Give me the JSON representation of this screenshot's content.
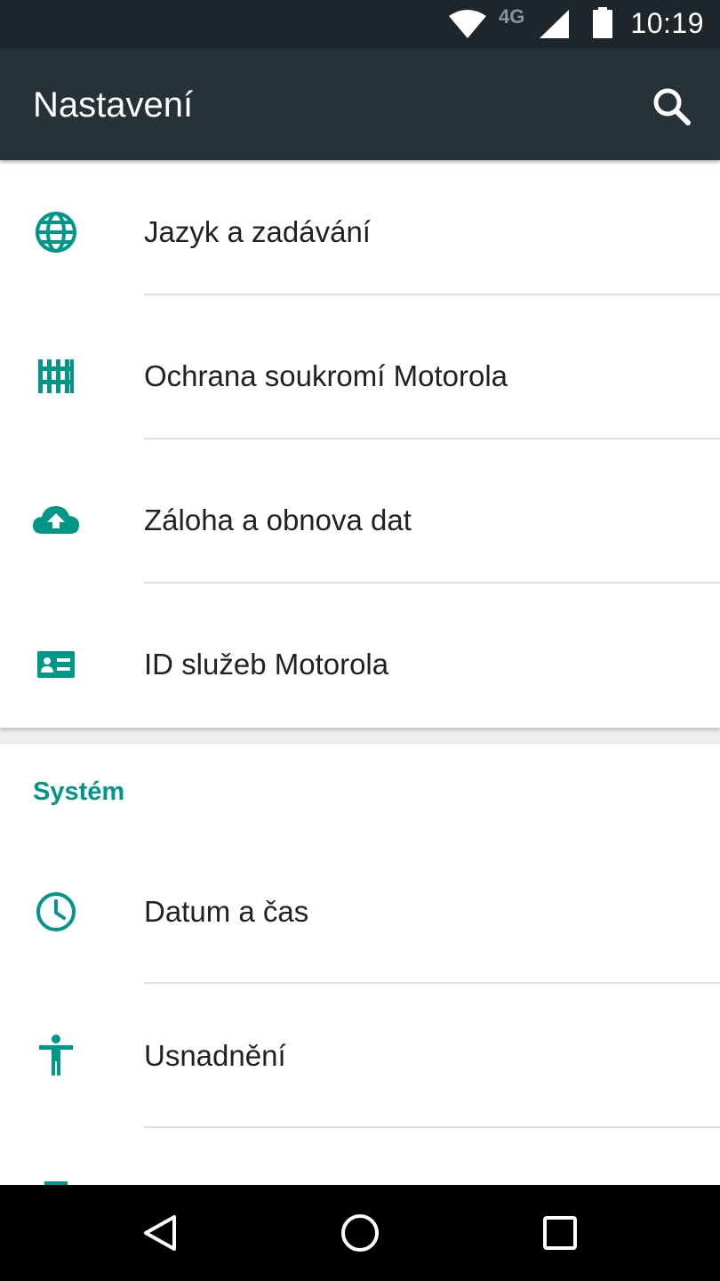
{
  "status_bar": {
    "network": "4G",
    "time": "10:19",
    "icons": [
      "wifi-icon",
      "cell-signal-icon",
      "battery-icon"
    ]
  },
  "app_bar": {
    "title": "Nastavení",
    "search_icon": "search-icon"
  },
  "accent_color": "#009688",
  "app_bar_color": "#263238",
  "personal_items": [
    {
      "label": "Jazyk a zadávání",
      "icon": "globe-icon"
    },
    {
      "label": "Ochrana soukromí Motorola",
      "icon": "fence-icon"
    },
    {
      "label": "Záloha a obnova dat",
      "icon": "cloud-upload-icon"
    },
    {
      "label": "ID služeb Motorola",
      "icon": "id-card-icon"
    }
  ],
  "system_section": {
    "header": "Systém",
    "items": [
      {
        "label": "Datum a čas",
        "icon": "clock-icon"
      },
      {
        "label": "Usnadnění",
        "icon": "accessibility-icon"
      }
    ]
  },
  "nav_bar": {
    "buttons": [
      "back-icon",
      "home-icon",
      "recents-icon"
    ]
  }
}
